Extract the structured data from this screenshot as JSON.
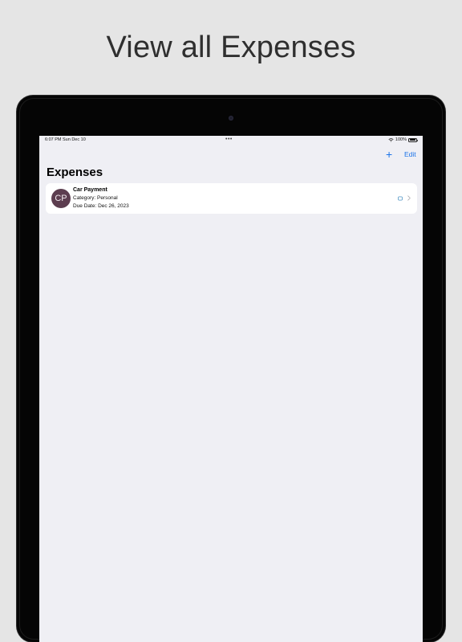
{
  "headline": "View all Expenses",
  "status_bar": {
    "time_date": "6:07 PM   Sun Dec 10",
    "center_dots": "•••",
    "battery_text": "100%"
  },
  "nav": {
    "add_symbol": "+",
    "edit_label": "Edit"
  },
  "page_title": "Expenses",
  "expenses": [
    {
      "initials": "CP",
      "title": "Car Payment",
      "category": "Category: Personal",
      "due_date": "Due Date: Dec 26, 2023"
    }
  ],
  "colors": {
    "accent": "#1b73e8",
    "avatar": "#5c3d4f",
    "background": "#efeff4"
  },
  "icons": {
    "wifi": "wifi-icon",
    "battery": "battery-icon",
    "document": "document-icon",
    "chevron": "chevron-right-icon"
  }
}
